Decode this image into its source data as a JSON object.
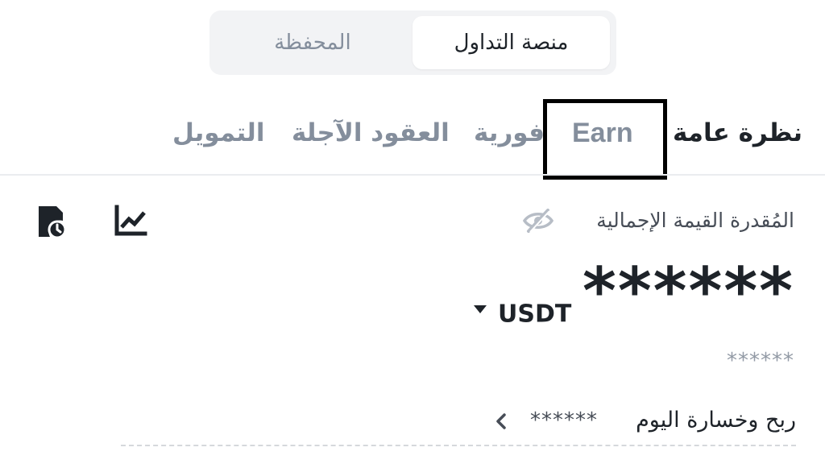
{
  "segmented": {
    "wallet_label": "المحفظة",
    "exchange_label": "منصة التداول",
    "selected": "exchange"
  },
  "tabs": [
    {
      "label": "نظرة عامة",
      "active": true
    },
    {
      "label": "Earn",
      "active": false,
      "highlighted": true
    },
    {
      "label": "فورية",
      "active": false
    },
    {
      "label": "العقود الآجلة",
      "active": false
    },
    {
      "label": "التمويل",
      "active": false
    }
  ],
  "toolbar": {
    "history_icon": "history-icon",
    "chart_icon": "chart-icon"
  },
  "balance": {
    "label": "المُقدرة القيمة الإجمالية",
    "visibility_icon": "eye-off-icon",
    "value": "******",
    "currency": "USDT",
    "secondary_value": "******"
  },
  "pnl": {
    "label": "ربح وخسارة اليوم",
    "value": "******"
  },
  "colors": {
    "text_primary": "#1e2329",
    "text_secondary": "#848e9c",
    "segment_bg": "#f2f3f5",
    "highlight_border": "#000000"
  }
}
